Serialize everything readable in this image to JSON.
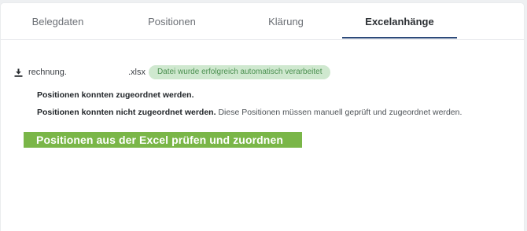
{
  "tabs": [
    {
      "label": "Belegdaten",
      "active": false
    },
    {
      "label": "Positionen",
      "active": false
    },
    {
      "label": "Klärung",
      "active": false
    },
    {
      "label": "Excelanhänge",
      "active": true
    }
  ],
  "attachment": {
    "icon": "download-icon",
    "file_name": "rechnung.",
    "file_ext": ".xlsx",
    "status_badge": "Datei wurde erfolgreich automatisch verarbeitet"
  },
  "messages": {
    "assigned": "Positionen konnten zugeordnet werden.",
    "not_assigned_bold": "Positionen konnten nicht zugeordnet werden.",
    "not_assigned_desc": "Diese Positionen müssen manuell geprüft und zugeordnet werden."
  },
  "actions": {
    "review_button": "Positionen aus der Excel prüfen und zuordnen"
  },
  "colors": {
    "accent_underline": "#2d4a7a",
    "button_green": "#7ab648",
    "badge_bg": "#cfe8cf",
    "badge_text": "#4a8f4f"
  }
}
